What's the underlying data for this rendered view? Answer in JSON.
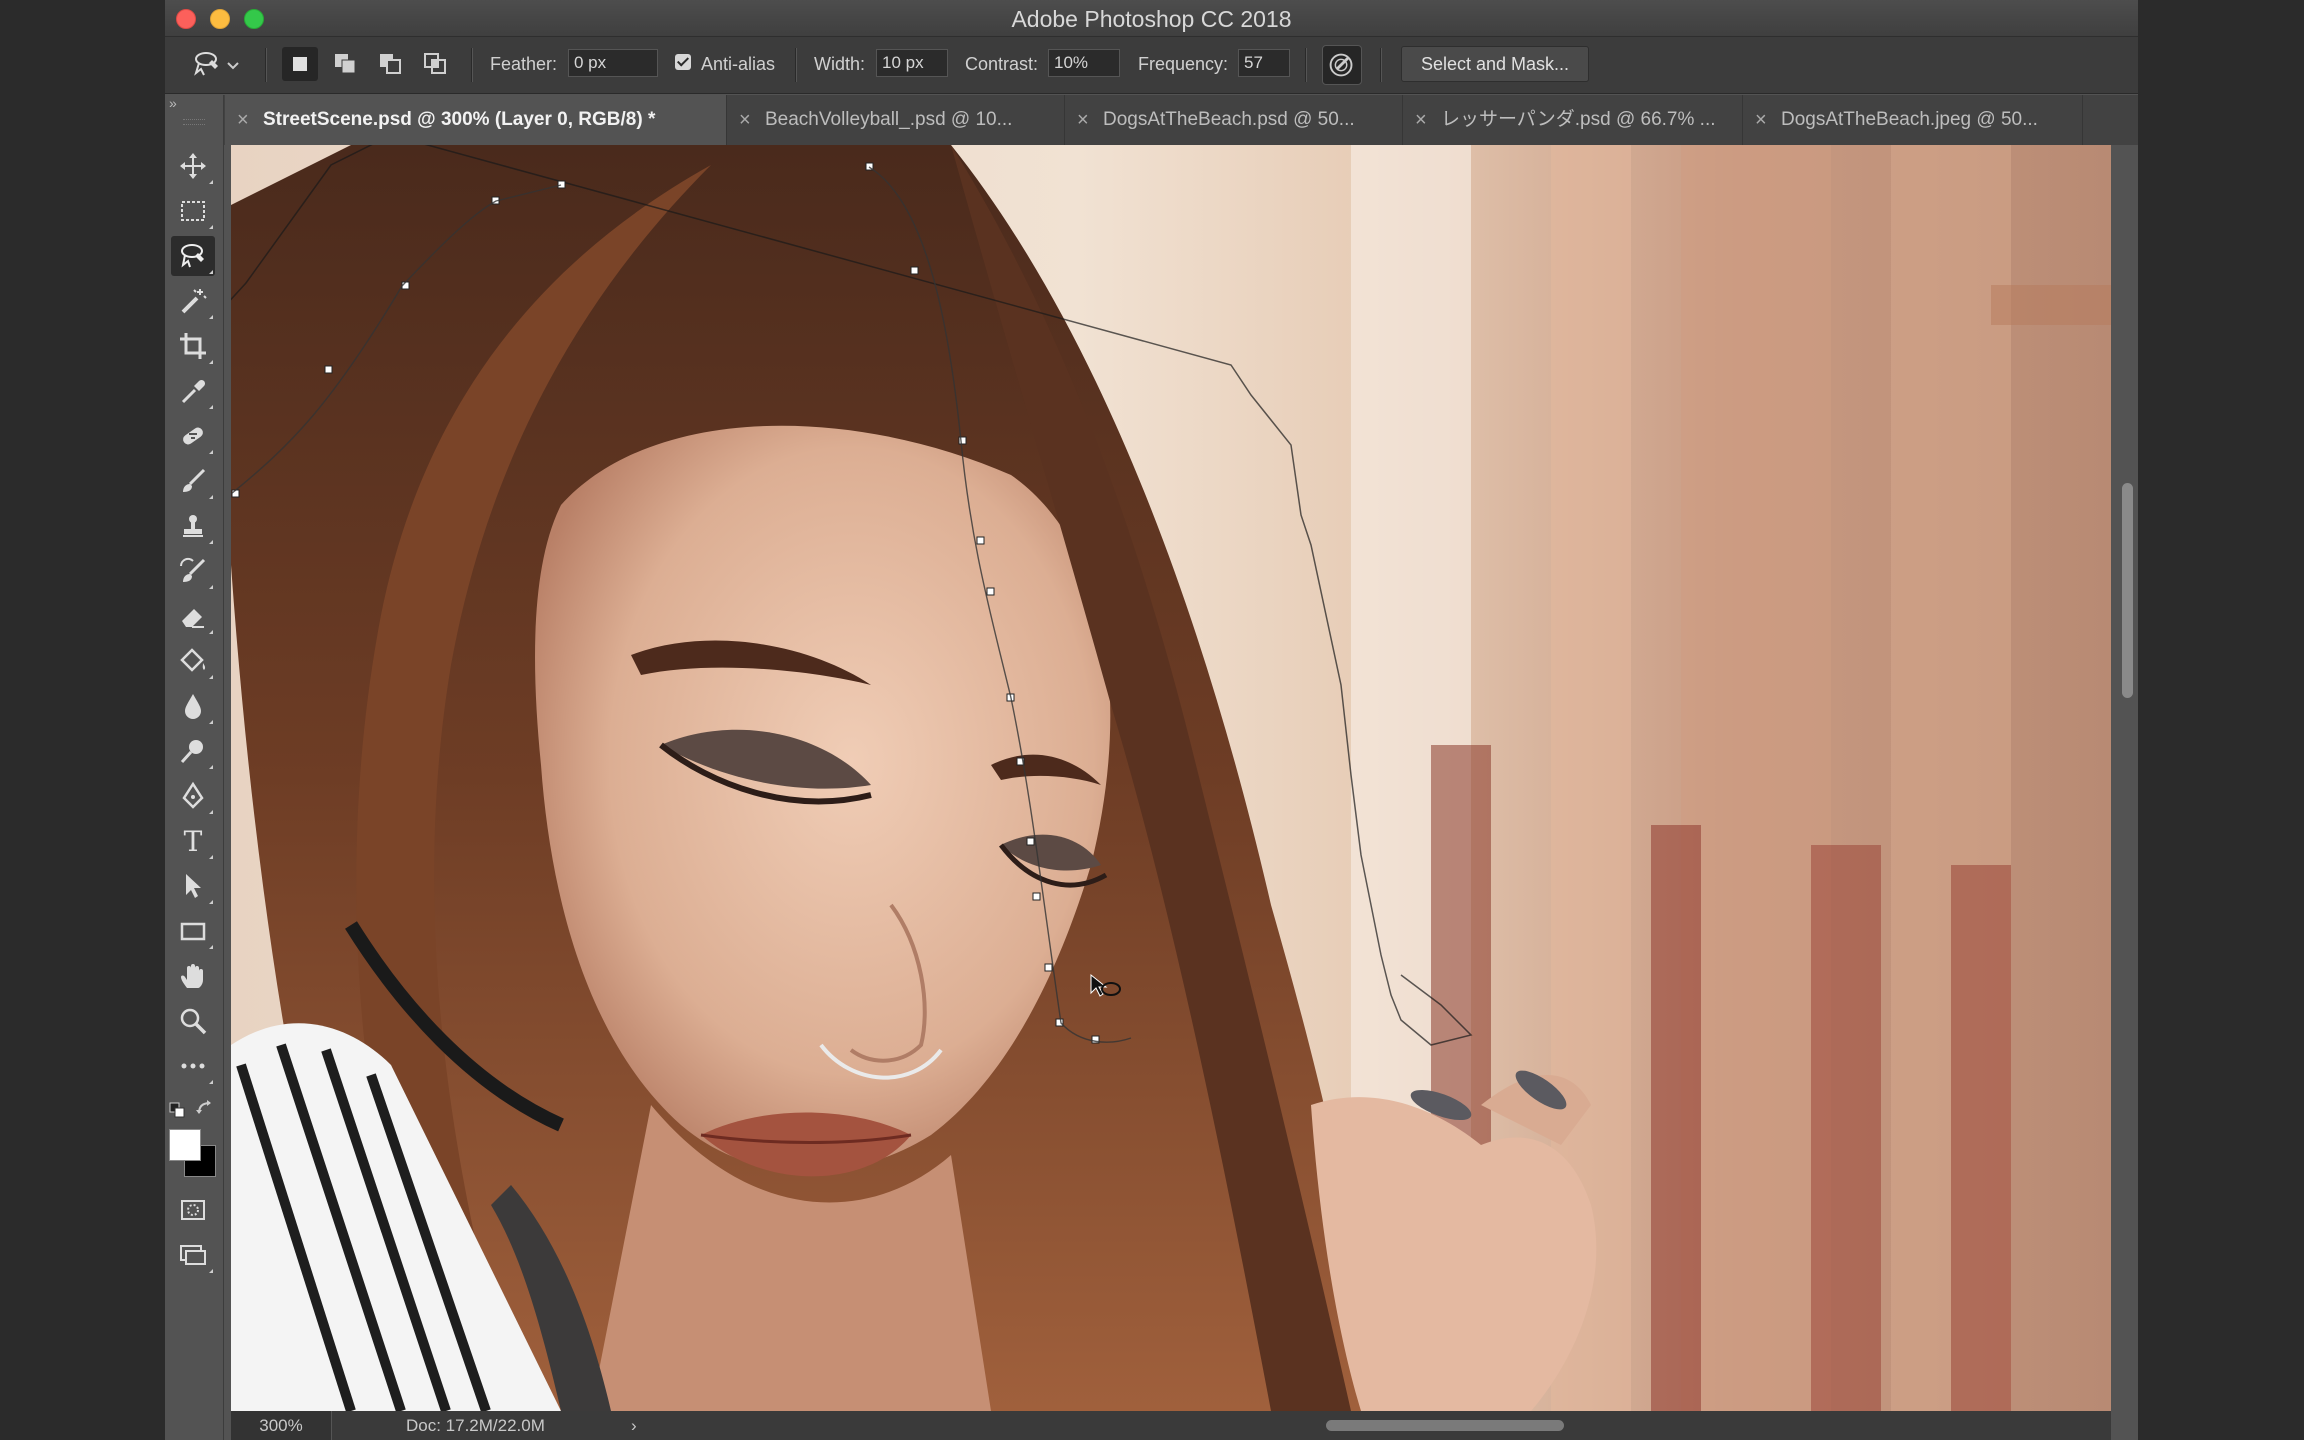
{
  "window": {
    "title": "Adobe Photoshop CC 2018"
  },
  "options_bar": {
    "tool_icon": "magnetic-lasso-icon",
    "selection_modes": [
      "new-selection-icon",
      "add-to-selection-icon",
      "subtract-from-selection-icon",
      "intersect-selection-icon"
    ],
    "feather_label": "Feather:",
    "feather_value": "0 px",
    "antialias_label": "Anti-alias",
    "antialias_checked": true,
    "width_label": "Width:",
    "width_value": "10 px",
    "contrast_label": "Contrast:",
    "contrast_value": "10%",
    "frequency_label": "Frequency:",
    "frequency_value": "57",
    "pen_pressure_icon": "stylus-pressure-icon",
    "select_mask_label": "Select and Mask..."
  },
  "panel_collapse": "»",
  "tabs": [
    {
      "label": "StreetScene.psd @ 300% (Layer 0, RGB/8) *",
      "active": true
    },
    {
      "label": "BeachVolleyball_.psd @ 10...",
      "active": false
    },
    {
      "label": "DogsAtTheBeach.psd @ 50...",
      "active": false
    },
    {
      "label": "レッサーパンダ.psd @ 66.7% ...",
      "active": false
    },
    {
      "label": "DogsAtTheBeach.jpeg @ 50...",
      "active": false
    }
  ],
  "tab_close": "×",
  "tools": [
    "move-tool-icon",
    "marquee-tool-icon",
    "magnetic-lasso-tool-icon",
    "magic-wand-tool-icon",
    "crop-tool-icon",
    "eyedropper-tool-icon",
    "healing-brush-tool-icon",
    "brush-tool-icon",
    "clone-stamp-tool-icon",
    "history-brush-tool-icon",
    "eraser-tool-icon",
    "paint-bucket-tool-icon",
    "blur-tool-icon",
    "dodge-tool-icon",
    "pen-tool-icon",
    "type-tool-icon",
    "path-selection-tool-icon",
    "rectangle-tool-icon",
    "hand-tool-icon",
    "zoom-tool-icon",
    "more-tools-icon"
  ],
  "type_tool_glyph": "T",
  "colors": {
    "foreground": "#ffffff",
    "background": "#000000",
    "ui_dark": "#3c3c3c",
    "ui_mid": "#535353"
  },
  "status": {
    "zoom": "300%",
    "doc": "Doc: 17.2M/22.0M",
    "arrow": "›"
  }
}
